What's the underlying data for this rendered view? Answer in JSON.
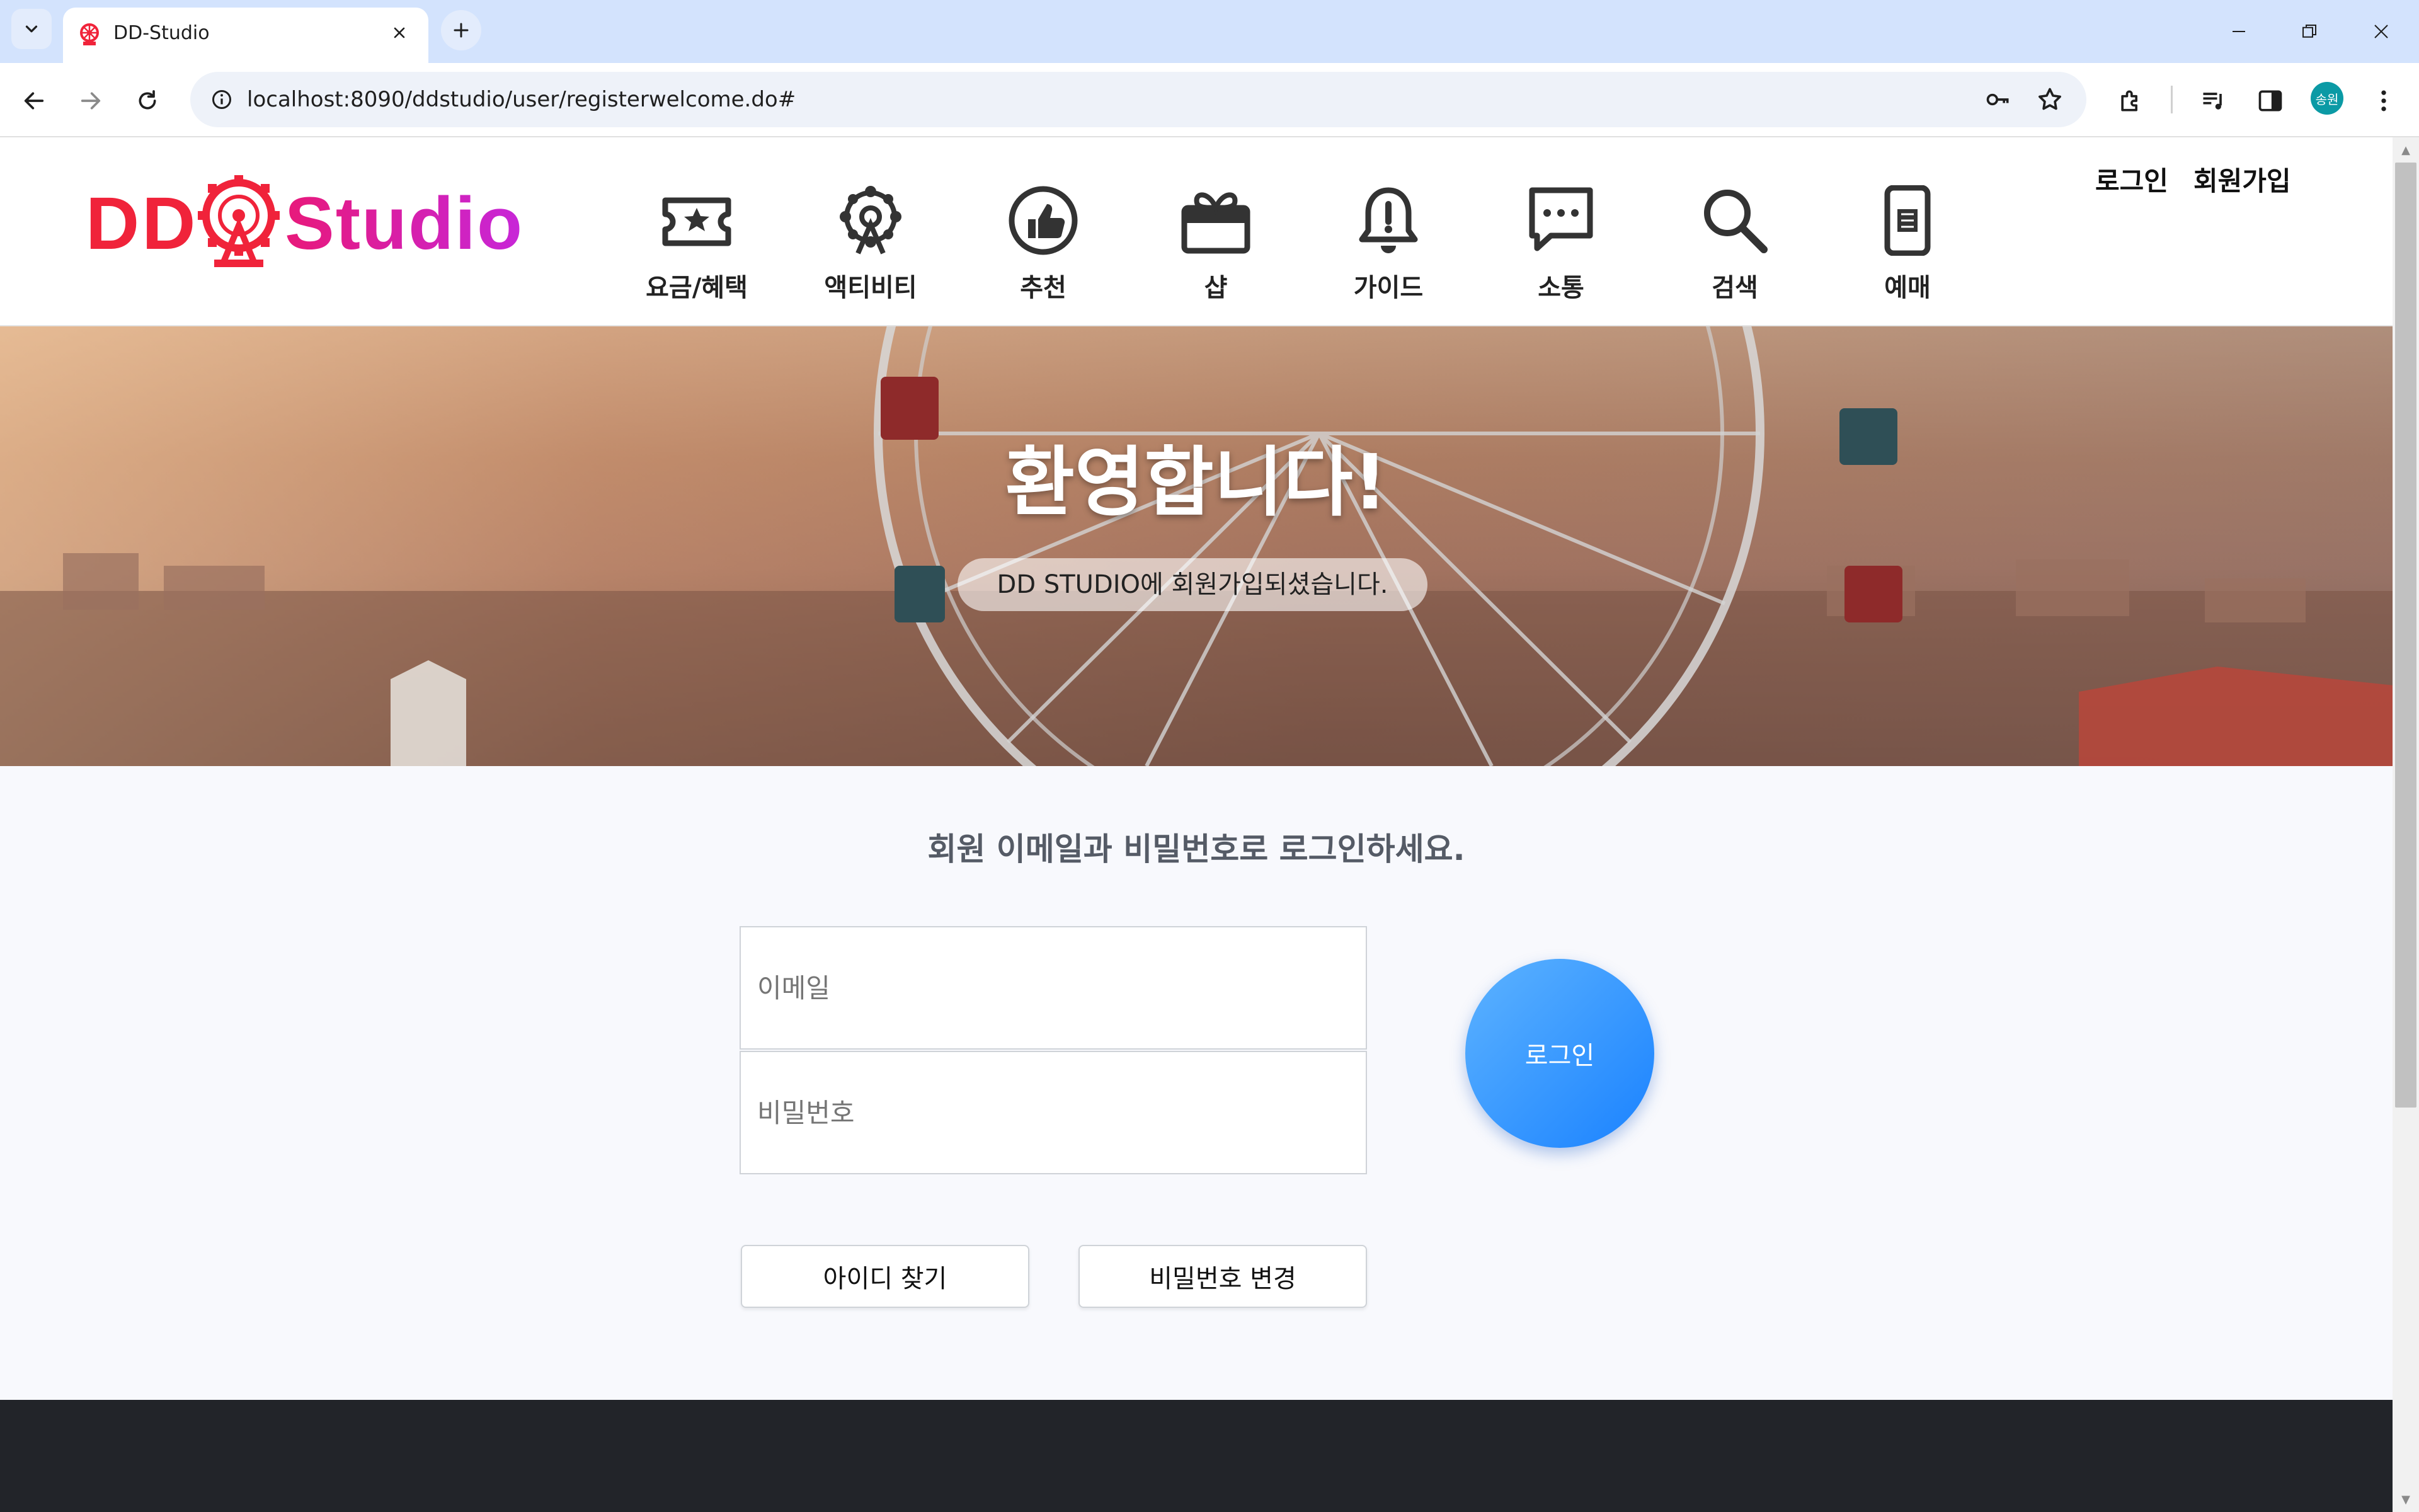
{
  "browser": {
    "tab_title": "DD-Studio",
    "url": "localhost:8090/ddstudio/user/registerwelcome.do#",
    "profile_initials": "송원"
  },
  "site": {
    "logo_left": "DD",
    "logo_right": "Studio",
    "nav": [
      {
        "label": "요금/혜택",
        "icon": "ticket-star-icon"
      },
      {
        "label": "액티비티",
        "icon": "ferris-wheel-icon"
      },
      {
        "label": "추천",
        "icon": "thumbs-up-icon"
      },
      {
        "label": "샵",
        "icon": "gift-box-icon"
      },
      {
        "label": "가이드",
        "icon": "bell-alert-icon"
      },
      {
        "label": "소통",
        "icon": "chat-bubble-icon"
      },
      {
        "label": "검색",
        "icon": "search-icon"
      },
      {
        "label": "예매",
        "icon": "mobile-ticket-icon"
      }
    ],
    "auth": {
      "login": "로그인",
      "register": "회원가입"
    }
  },
  "hero": {
    "title": "환영합니다!",
    "subtitle": "DD STUDIO에 회원가입되셨습니다."
  },
  "login_form": {
    "instruction": "회원 이메일과 비밀번호로 로그인하세요.",
    "email_placeholder": "이메일",
    "password_placeholder": "비밀번호",
    "login_button": "로그인",
    "find_id_button": "아이디 찾기",
    "change_password_button": "비밀번호 변경"
  },
  "colors": {
    "brand_red": "#f0233a",
    "brand_pink": "#e8197a",
    "brand_purple": "#c726d9",
    "login_blue": "#1a82ff",
    "footer_dark": "#222429"
  }
}
